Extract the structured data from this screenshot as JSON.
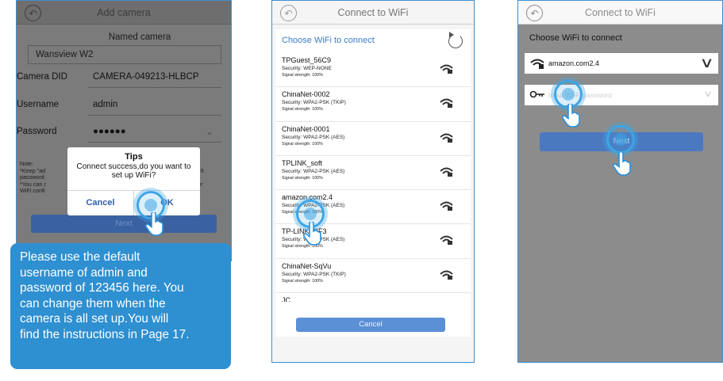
{
  "phone1": {
    "title": "Add camera",
    "named_label": "Named camera",
    "name_value": "Wansview W2",
    "rows": [
      {
        "label": "Camera DID",
        "value": "CAMERA-049213-HLBCP"
      },
      {
        "label": "Username",
        "value": "admin"
      },
      {
        "label": "Password",
        "value": "●●●●●●"
      }
    ],
    "note_lines": [
      "Note:",
      "*Keep \"ad",
      "password",
      "*You can r",
      "WiFi confi"
    ],
    "note_right_lines": [
      "lt",
      "d after"
    ],
    "next": "Next",
    "dialog": {
      "title": "Tips",
      "message": "Connect success,do you want to set up WiFi?",
      "cancel": "Cancel",
      "ok": "OK"
    }
  },
  "tip_lines": [
    "Please use the default",
    "username of admin and",
    "password of 123456 here. You",
    "can change them when the",
    "camera is all set up.You will",
    "find the instructions in Page 17."
  ],
  "phone2": {
    "title": "Connect to WiFi",
    "heading": "Choose WiFi to connect",
    "networks": [
      {
        "ssid": "TPGuest_56C9",
        "security": "Security: WEP-NONE",
        "signal": "Signal strength: 100%"
      },
      {
        "ssid": "ChinaNet-0002",
        "security": "Security: WPA2-PSK (TKIP)",
        "signal": "Signal strength: 100%"
      },
      {
        "ssid": "ChinaNet-0001",
        "security": "Security: WPA2-PSK (AES)",
        "signal": "Signal strength: 100%"
      },
      {
        "ssid": "TPLINK_soft",
        "security": "Security: WPA2-PSK (AES)",
        "signal": "Signal strength: 100%"
      },
      {
        "ssid": "amazon.com2.4",
        "security": "Security: WPA2-PSK (AES)",
        "signal": "Signal strength: 100%"
      },
      {
        "ssid": "TP-LINK_CF3",
        "security": "Security: WPA2-PSK (AES)",
        "signal": "Signal strength: 100%"
      },
      {
        "ssid": "ChinaNet-SqVu",
        "security": "Security: WPA2-PSK (TKIP)",
        "signal": "Signal strength: 100%"
      },
      {
        "ssid": "JC",
        "security": "",
        "signal": ""
      }
    ],
    "cancel": "Cancel"
  },
  "phone3": {
    "title": "Connect to WiFi",
    "heading": "Choose WiFi to connect",
    "selected_ssid": "amazon.com2.4",
    "password_placeholder": "Input Wi-Fi password",
    "next": "Next"
  },
  "colors": {
    "frame_border": "#3f8fd0",
    "tip_bg": "#2e8fd1",
    "button_blue": "#5b8fd6",
    "tap_ring": "#3ea5e6",
    "link_blue": "#3b7cc9"
  },
  "icons": [
    "back-arrow-icon",
    "refresh-icon",
    "wifi-icon",
    "key-icon",
    "chevron-down-icon",
    "tap-ring-icon",
    "pointing-hand-icon"
  ]
}
